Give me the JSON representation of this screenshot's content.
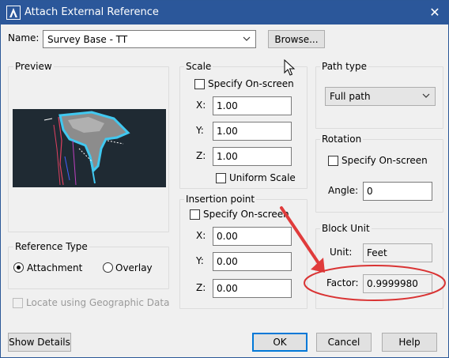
{
  "window": {
    "title": "Attach External Reference",
    "close_glyph": "✕"
  },
  "name_field": {
    "label": "Name:",
    "value": "Survey Base - TT"
  },
  "browse_button": "Browse...",
  "preview": {
    "title": "Preview"
  },
  "scale": {
    "title": "Scale",
    "specify_onscreen": "Specify On-screen",
    "x_label": "X:",
    "x_value": "1.00",
    "y_label": "Y:",
    "y_value": "1.00",
    "z_label": "Z:",
    "z_value": "1.00",
    "uniform_scale": "Uniform Scale"
  },
  "insertion_point": {
    "title": "Insertion point",
    "specify_onscreen": "Specify On-screen",
    "x_label": "X:",
    "x_value": "0.00",
    "y_label": "Y:",
    "y_value": "0.00",
    "z_label": "Z:",
    "z_value": "0.00"
  },
  "path_type": {
    "title": "Path type",
    "value": "Full path"
  },
  "rotation": {
    "title": "Rotation",
    "specify_onscreen": "Specify On-screen",
    "angle_label": "Angle:",
    "angle_value": "0"
  },
  "block_unit": {
    "title": "Block Unit",
    "unit_label": "Unit:",
    "unit_value": "Feet",
    "factor_label": "Factor:",
    "factor_value": "0.9999980"
  },
  "reference_type": {
    "title": "Reference Type",
    "attachment": "Attachment",
    "overlay": "Overlay",
    "selected": "Attachment"
  },
  "locate_geo": "Locate using Geographic Data",
  "buttons": {
    "show_details": "Show Details",
    "ok": "OK",
    "cancel": "Cancel",
    "help": "Help"
  },
  "colors": {
    "titlebar": "#2b579a",
    "annotation": "#e03b3b",
    "focus_border": "#0078d7"
  },
  "icons": {
    "app": "autocad-a-icon",
    "close": "close-icon",
    "cursor": "mouse-pointer-icon",
    "arrow": "red-annotation-arrow"
  }
}
